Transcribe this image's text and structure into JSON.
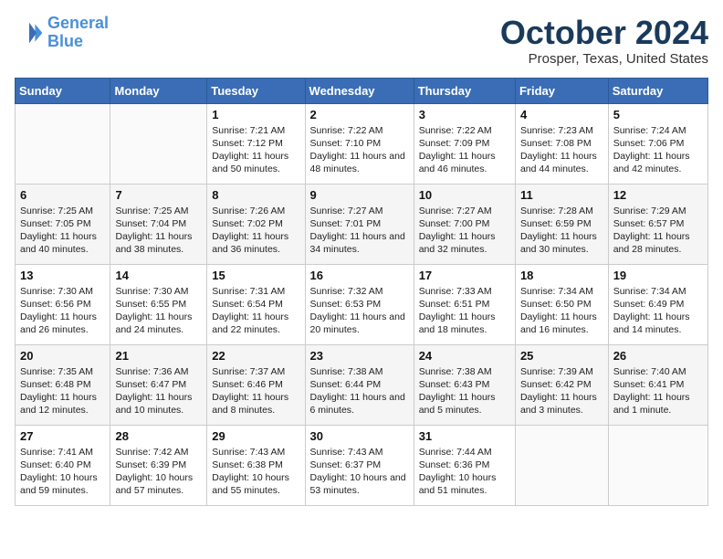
{
  "logo": {
    "line1": "General",
    "line2": "Blue"
  },
  "title": "October 2024",
  "location": "Prosper, Texas, United States",
  "days_of_week": [
    "Sunday",
    "Monday",
    "Tuesday",
    "Wednesday",
    "Thursday",
    "Friday",
    "Saturday"
  ],
  "weeks": [
    [
      {
        "day": "",
        "info": ""
      },
      {
        "day": "",
        "info": ""
      },
      {
        "day": "1",
        "info": "Sunrise: 7:21 AM\nSunset: 7:12 PM\nDaylight: 11 hours and 50 minutes."
      },
      {
        "day": "2",
        "info": "Sunrise: 7:22 AM\nSunset: 7:10 PM\nDaylight: 11 hours and 48 minutes."
      },
      {
        "day": "3",
        "info": "Sunrise: 7:22 AM\nSunset: 7:09 PM\nDaylight: 11 hours and 46 minutes."
      },
      {
        "day": "4",
        "info": "Sunrise: 7:23 AM\nSunset: 7:08 PM\nDaylight: 11 hours and 44 minutes."
      },
      {
        "day": "5",
        "info": "Sunrise: 7:24 AM\nSunset: 7:06 PM\nDaylight: 11 hours and 42 minutes."
      }
    ],
    [
      {
        "day": "6",
        "info": "Sunrise: 7:25 AM\nSunset: 7:05 PM\nDaylight: 11 hours and 40 minutes."
      },
      {
        "day": "7",
        "info": "Sunrise: 7:25 AM\nSunset: 7:04 PM\nDaylight: 11 hours and 38 minutes."
      },
      {
        "day": "8",
        "info": "Sunrise: 7:26 AM\nSunset: 7:02 PM\nDaylight: 11 hours and 36 minutes."
      },
      {
        "day": "9",
        "info": "Sunrise: 7:27 AM\nSunset: 7:01 PM\nDaylight: 11 hours and 34 minutes."
      },
      {
        "day": "10",
        "info": "Sunrise: 7:27 AM\nSunset: 7:00 PM\nDaylight: 11 hours and 32 minutes."
      },
      {
        "day": "11",
        "info": "Sunrise: 7:28 AM\nSunset: 6:59 PM\nDaylight: 11 hours and 30 minutes."
      },
      {
        "day": "12",
        "info": "Sunrise: 7:29 AM\nSunset: 6:57 PM\nDaylight: 11 hours and 28 minutes."
      }
    ],
    [
      {
        "day": "13",
        "info": "Sunrise: 7:30 AM\nSunset: 6:56 PM\nDaylight: 11 hours and 26 minutes."
      },
      {
        "day": "14",
        "info": "Sunrise: 7:30 AM\nSunset: 6:55 PM\nDaylight: 11 hours and 24 minutes."
      },
      {
        "day": "15",
        "info": "Sunrise: 7:31 AM\nSunset: 6:54 PM\nDaylight: 11 hours and 22 minutes."
      },
      {
        "day": "16",
        "info": "Sunrise: 7:32 AM\nSunset: 6:53 PM\nDaylight: 11 hours and 20 minutes."
      },
      {
        "day": "17",
        "info": "Sunrise: 7:33 AM\nSunset: 6:51 PM\nDaylight: 11 hours and 18 minutes."
      },
      {
        "day": "18",
        "info": "Sunrise: 7:34 AM\nSunset: 6:50 PM\nDaylight: 11 hours and 16 minutes."
      },
      {
        "day": "19",
        "info": "Sunrise: 7:34 AM\nSunset: 6:49 PM\nDaylight: 11 hours and 14 minutes."
      }
    ],
    [
      {
        "day": "20",
        "info": "Sunrise: 7:35 AM\nSunset: 6:48 PM\nDaylight: 11 hours and 12 minutes."
      },
      {
        "day": "21",
        "info": "Sunrise: 7:36 AM\nSunset: 6:47 PM\nDaylight: 11 hours and 10 minutes."
      },
      {
        "day": "22",
        "info": "Sunrise: 7:37 AM\nSunset: 6:46 PM\nDaylight: 11 hours and 8 minutes."
      },
      {
        "day": "23",
        "info": "Sunrise: 7:38 AM\nSunset: 6:44 PM\nDaylight: 11 hours and 6 minutes."
      },
      {
        "day": "24",
        "info": "Sunrise: 7:38 AM\nSunset: 6:43 PM\nDaylight: 11 hours and 5 minutes."
      },
      {
        "day": "25",
        "info": "Sunrise: 7:39 AM\nSunset: 6:42 PM\nDaylight: 11 hours and 3 minutes."
      },
      {
        "day": "26",
        "info": "Sunrise: 7:40 AM\nSunset: 6:41 PM\nDaylight: 11 hours and 1 minute."
      }
    ],
    [
      {
        "day": "27",
        "info": "Sunrise: 7:41 AM\nSunset: 6:40 PM\nDaylight: 10 hours and 59 minutes."
      },
      {
        "day": "28",
        "info": "Sunrise: 7:42 AM\nSunset: 6:39 PM\nDaylight: 10 hours and 57 minutes."
      },
      {
        "day": "29",
        "info": "Sunrise: 7:43 AM\nSunset: 6:38 PM\nDaylight: 10 hours and 55 minutes."
      },
      {
        "day": "30",
        "info": "Sunrise: 7:43 AM\nSunset: 6:37 PM\nDaylight: 10 hours and 53 minutes."
      },
      {
        "day": "31",
        "info": "Sunrise: 7:44 AM\nSunset: 6:36 PM\nDaylight: 10 hours and 51 minutes."
      },
      {
        "day": "",
        "info": ""
      },
      {
        "day": "",
        "info": ""
      }
    ]
  ]
}
